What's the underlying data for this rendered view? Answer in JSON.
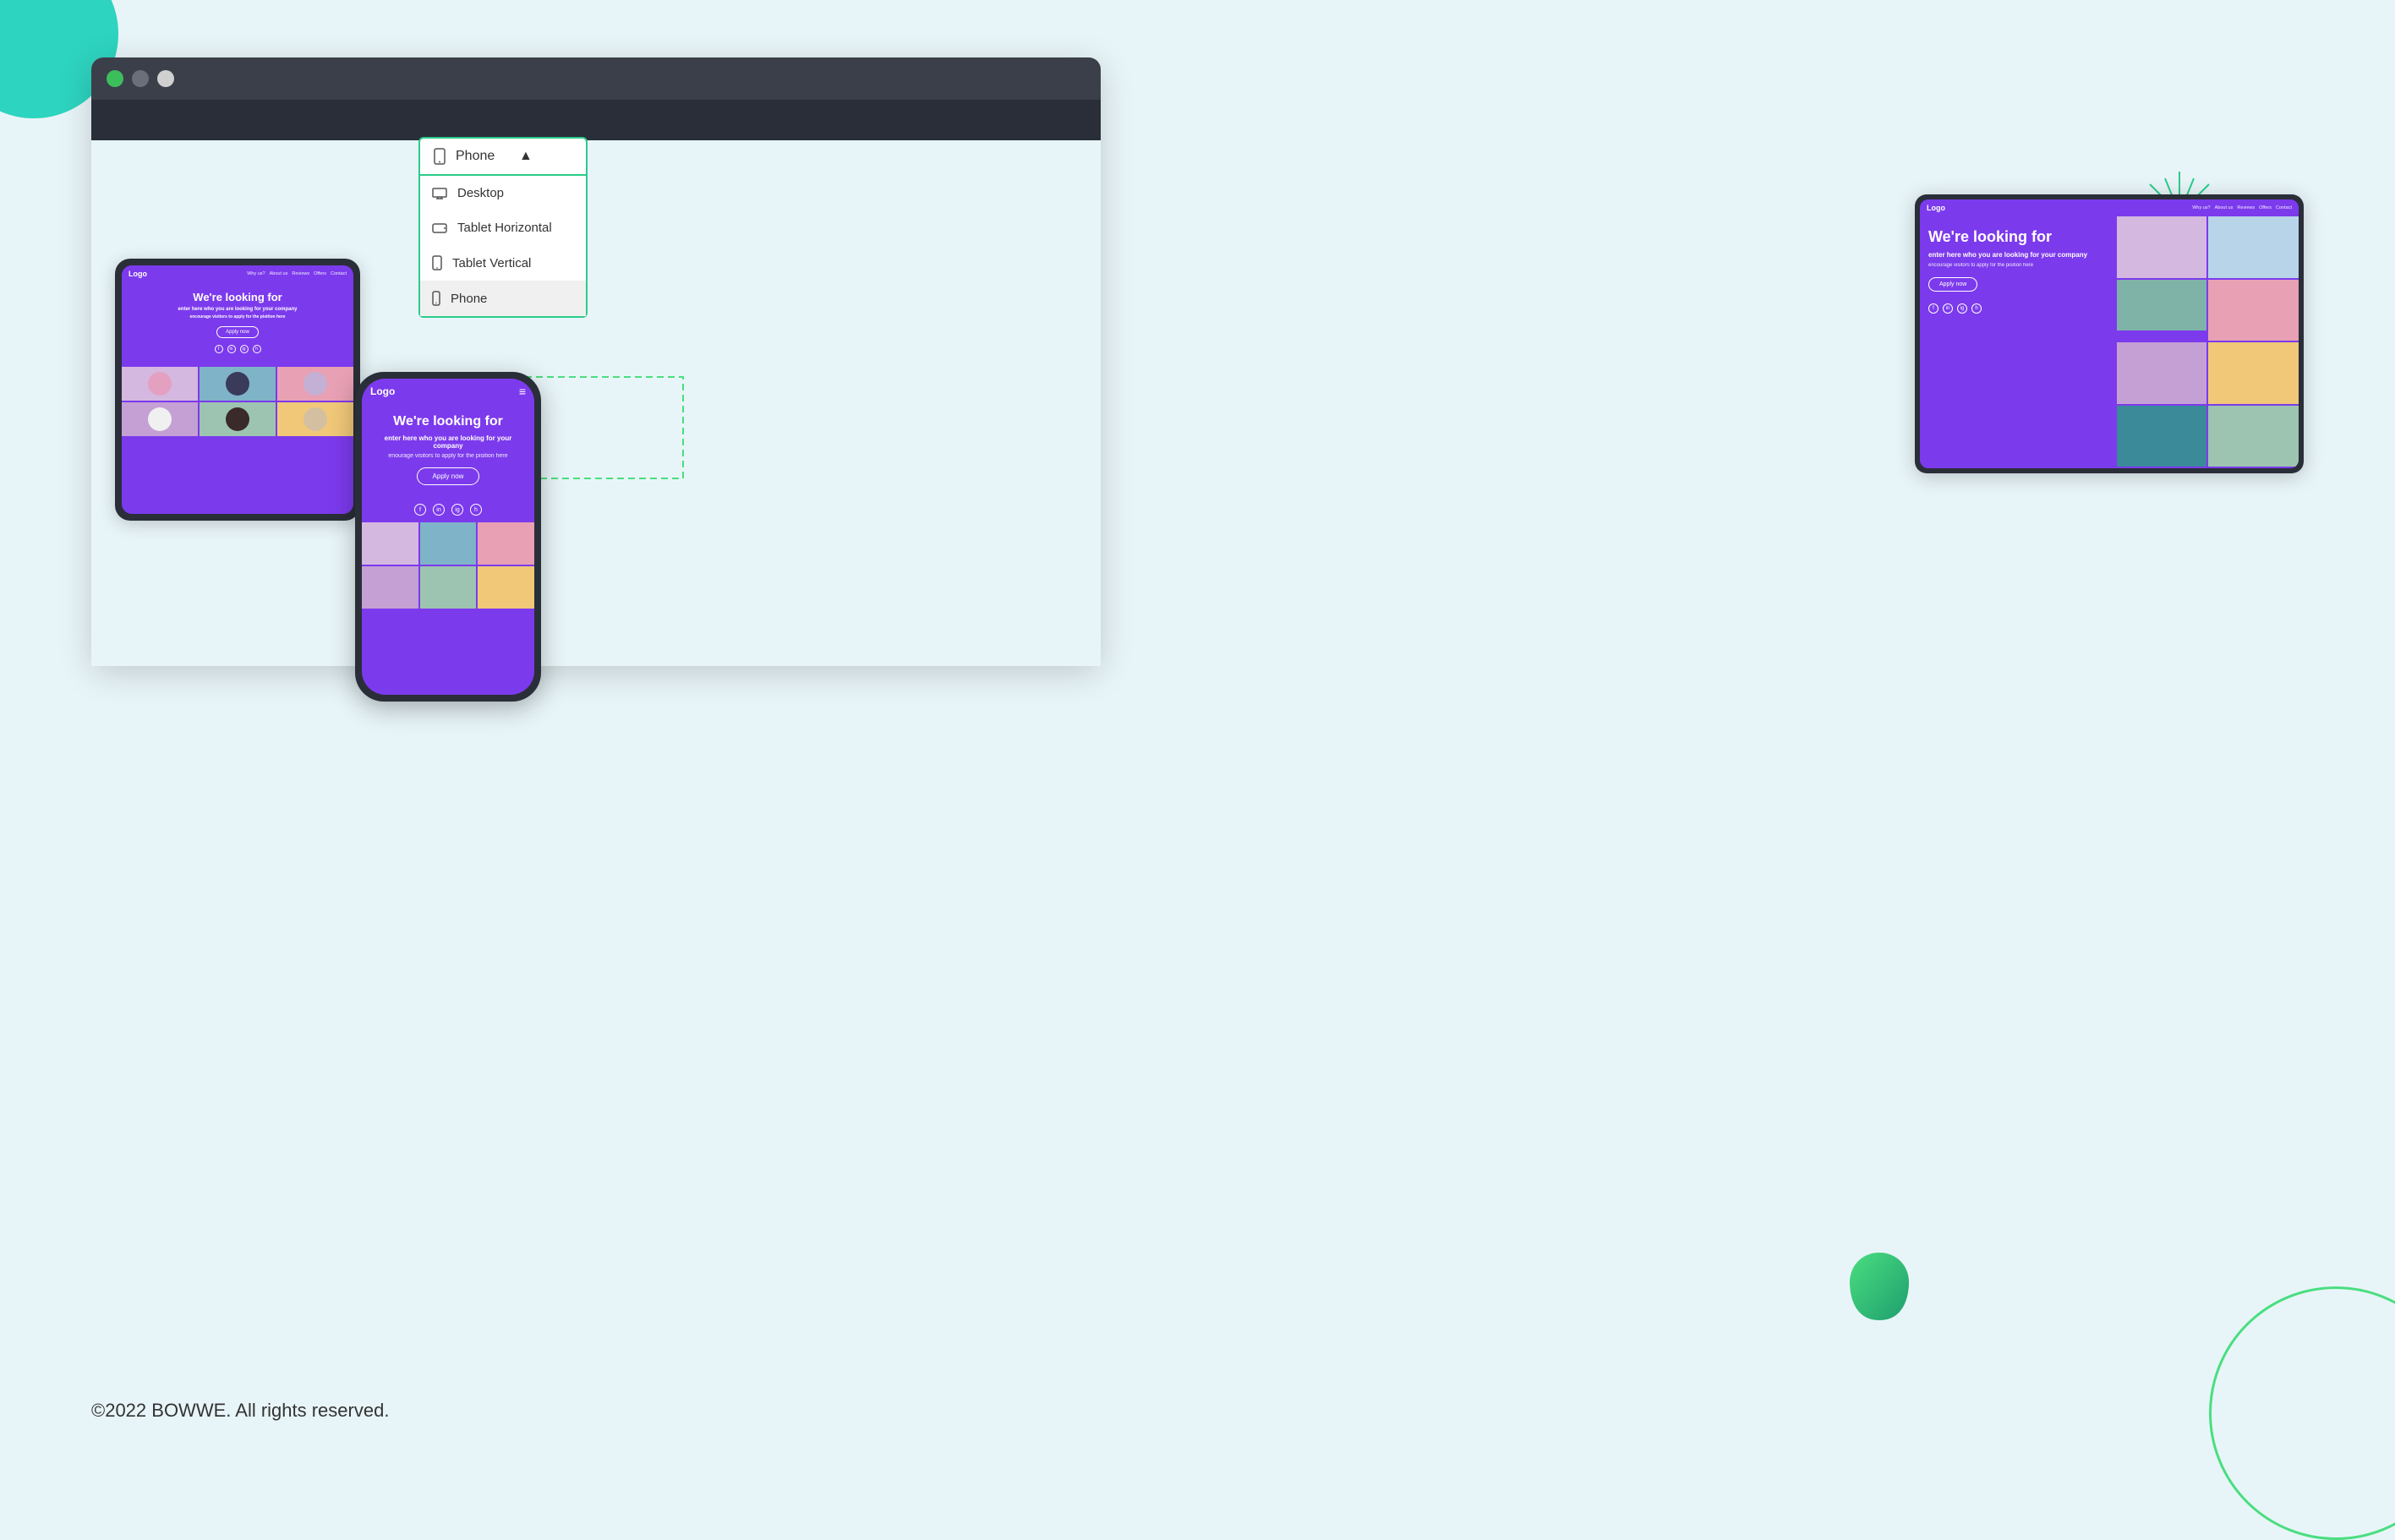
{
  "page": {
    "background_color": "#e8f5f8",
    "footer_text": "©2022 BOWWE. All rights reserved."
  },
  "browser": {
    "dots": [
      "green",
      "dark",
      "light"
    ],
    "dot_colors": [
      "#3dbe5c",
      "#6b6f7a",
      "#d0d0d0"
    ]
  },
  "dropdown": {
    "selected": "Phone",
    "options": [
      {
        "label": "Desktop",
        "icon": "desktop-icon"
      },
      {
        "label": "Tablet Horizontal",
        "icon": "tablet-horizontal-icon"
      },
      {
        "label": "Tablet Vertical",
        "icon": "tablet-vertical-icon"
      },
      {
        "label": "Phone",
        "icon": "phone-icon",
        "active": true
      }
    ]
  },
  "website": {
    "logo": "Logo",
    "nav_links": [
      "Why us?",
      "About us",
      "Reviews",
      "Offers",
      "Contact"
    ],
    "heading": "We're looking for",
    "subheading": "enter here who you are looking for your company",
    "body_text": "encourage visitors to apply for the pisition here",
    "apply_button": "Apply now",
    "social_icons": [
      "f",
      "in",
      "ig",
      "h"
    ]
  },
  "phone_website": {
    "logo": "Logo",
    "menu_icon": "≡",
    "heading": "We're looking for",
    "subheading": "enter here who you are looking for your company",
    "body_text": "enourage visitors to apply for the pisition here",
    "apply_button": "Apply now"
  },
  "right_tablet": {
    "logo": "Logo",
    "nav_links": [
      "Why us?",
      "About us",
      "Reviews",
      "Offers",
      "Contact"
    ],
    "heading": "We're looking for",
    "subheading": "enter here who you are looking for your company",
    "body_text": "encourage visitors to apply for the pisition here",
    "apply_button": "Apply now"
  }
}
